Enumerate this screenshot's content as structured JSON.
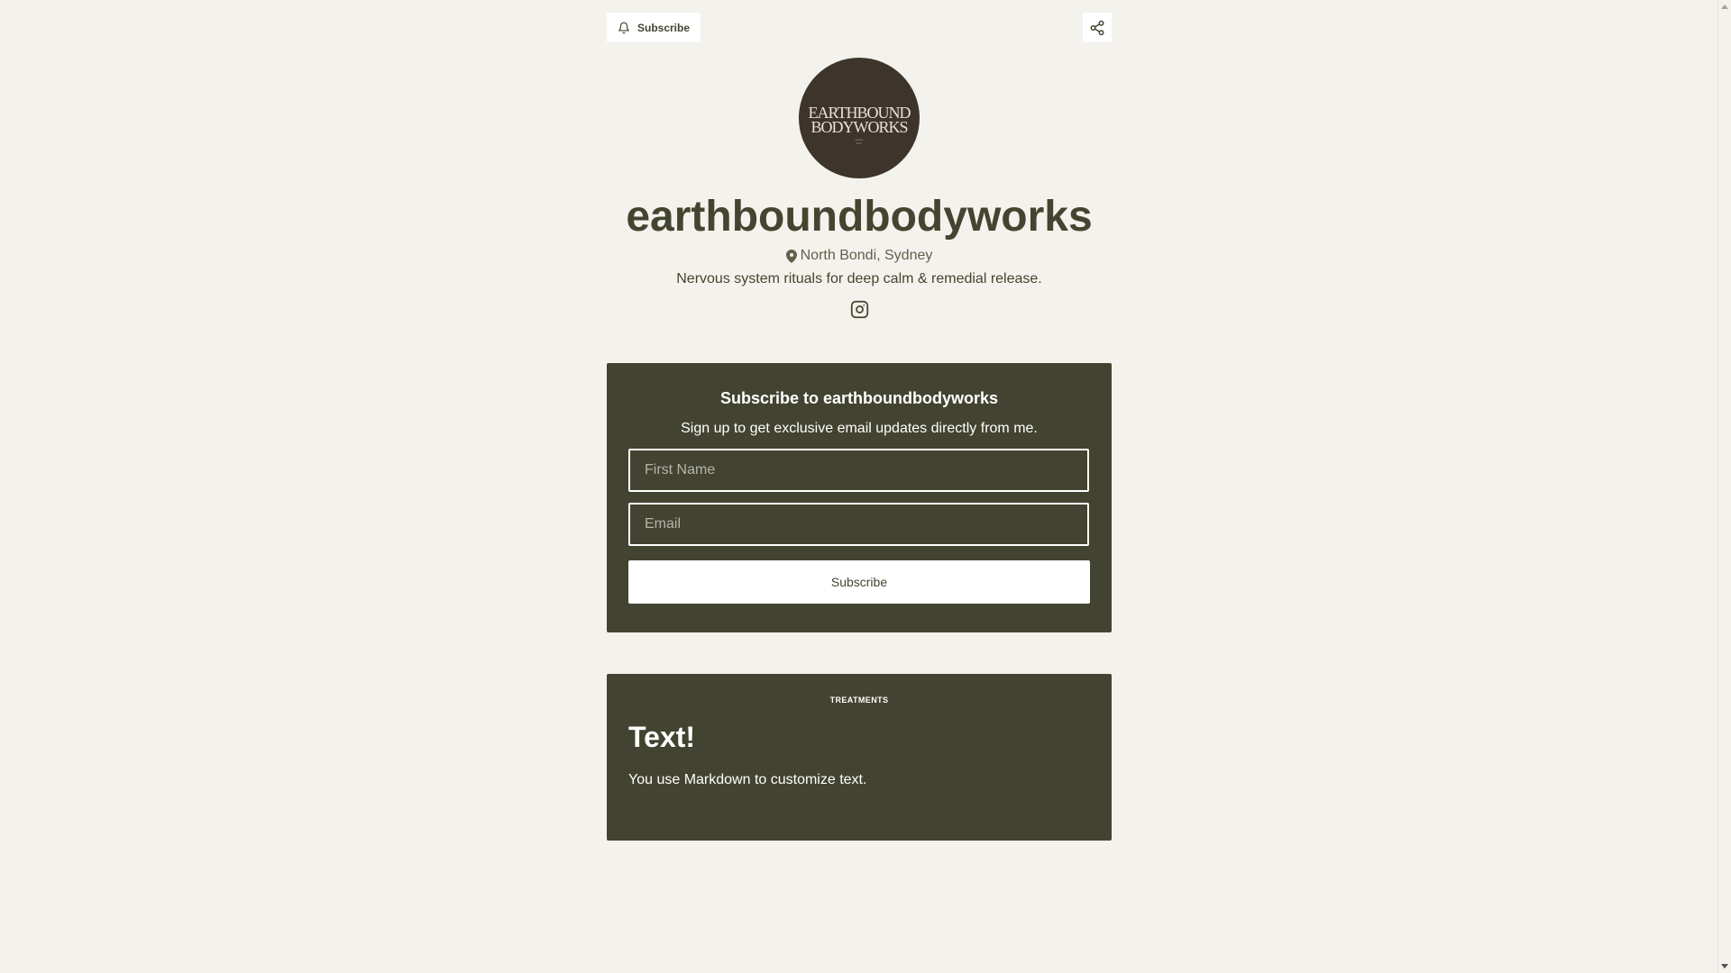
{
  "header": {
    "subscribe_label": "Subscribe"
  },
  "profile": {
    "avatar_text_line1": "EARTHBOUND",
    "avatar_text_line2": "BODYWORKS",
    "name": "earthboundbodyworks",
    "location": "North Bondi, Sydney",
    "bio": "Nervous system rituals for deep calm & remedial release."
  },
  "subscribe_card": {
    "title": "Subscribe to earthboundbodyworks",
    "description": "Sign up to get exclusive email updates directly from me.",
    "first_name_placeholder": "First Name",
    "email_placeholder": "Email",
    "button_label": "Subscribe"
  },
  "text_card": {
    "section_label": "TREATMENTS",
    "heading": "Text!",
    "body": "You use Markdown to customize text."
  },
  "icons": {
    "subscribe": "bell-icon",
    "share": "share-icon",
    "location": "map-pin-icon",
    "social": "instagram-icon"
  },
  "colors": {
    "background": "#f4f2ec",
    "card": "#434331",
    "primary_text": "#434530",
    "button": "#ffffff"
  }
}
